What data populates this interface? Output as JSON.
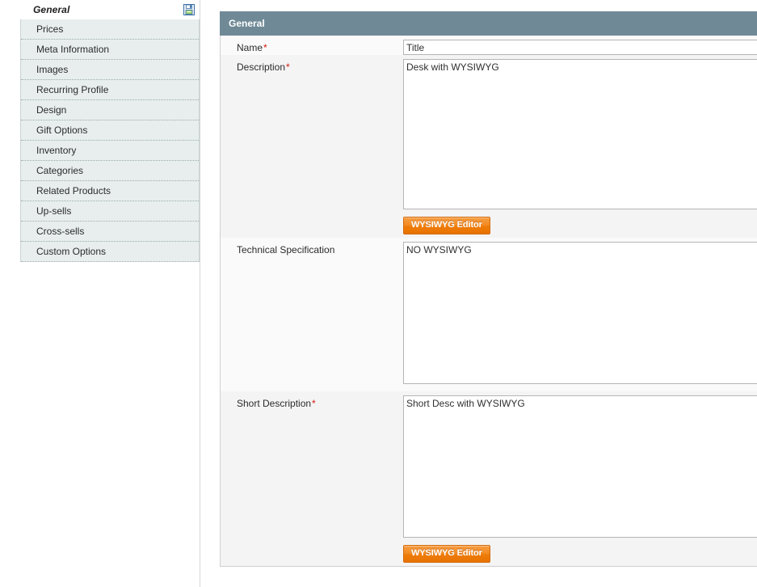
{
  "sidebar": {
    "header_title": "General",
    "save_icon": "save-disk-icon",
    "items": [
      {
        "label": "Prices"
      },
      {
        "label": "Meta Information"
      },
      {
        "label": "Images"
      },
      {
        "label": "Recurring Profile"
      },
      {
        "label": "Design"
      },
      {
        "label": "Gift Options"
      },
      {
        "label": "Inventory"
      },
      {
        "label": "Categories"
      },
      {
        "label": "Related Products"
      },
      {
        "label": "Up-sells"
      },
      {
        "label": "Cross-sells"
      },
      {
        "label": "Custom Options"
      }
    ]
  },
  "panel": {
    "header_title": "General",
    "header_bg": "#6f8a96",
    "required_marker": "*",
    "accent_button_color": "#ef7d0b",
    "fields": [
      {
        "label": "Name",
        "required": true,
        "type": "text",
        "value": "Title",
        "placeholder": ""
      },
      {
        "label": "Description",
        "required": true,
        "type": "textarea",
        "value": "Desk with WYSIWYG",
        "placeholder": "",
        "editor_button": "WYSIWYG Editor"
      },
      {
        "label": "Technical Specification",
        "required": false,
        "type": "textarea",
        "value": "NO WYSIWYG",
        "placeholder": "",
        "editor_button": null
      },
      {
        "label": "Short Description",
        "required": true,
        "type": "textarea",
        "value": "Short Desc with WYSIWYG",
        "placeholder": "",
        "editor_button": "WYSIWYG Editor"
      }
    ]
  }
}
